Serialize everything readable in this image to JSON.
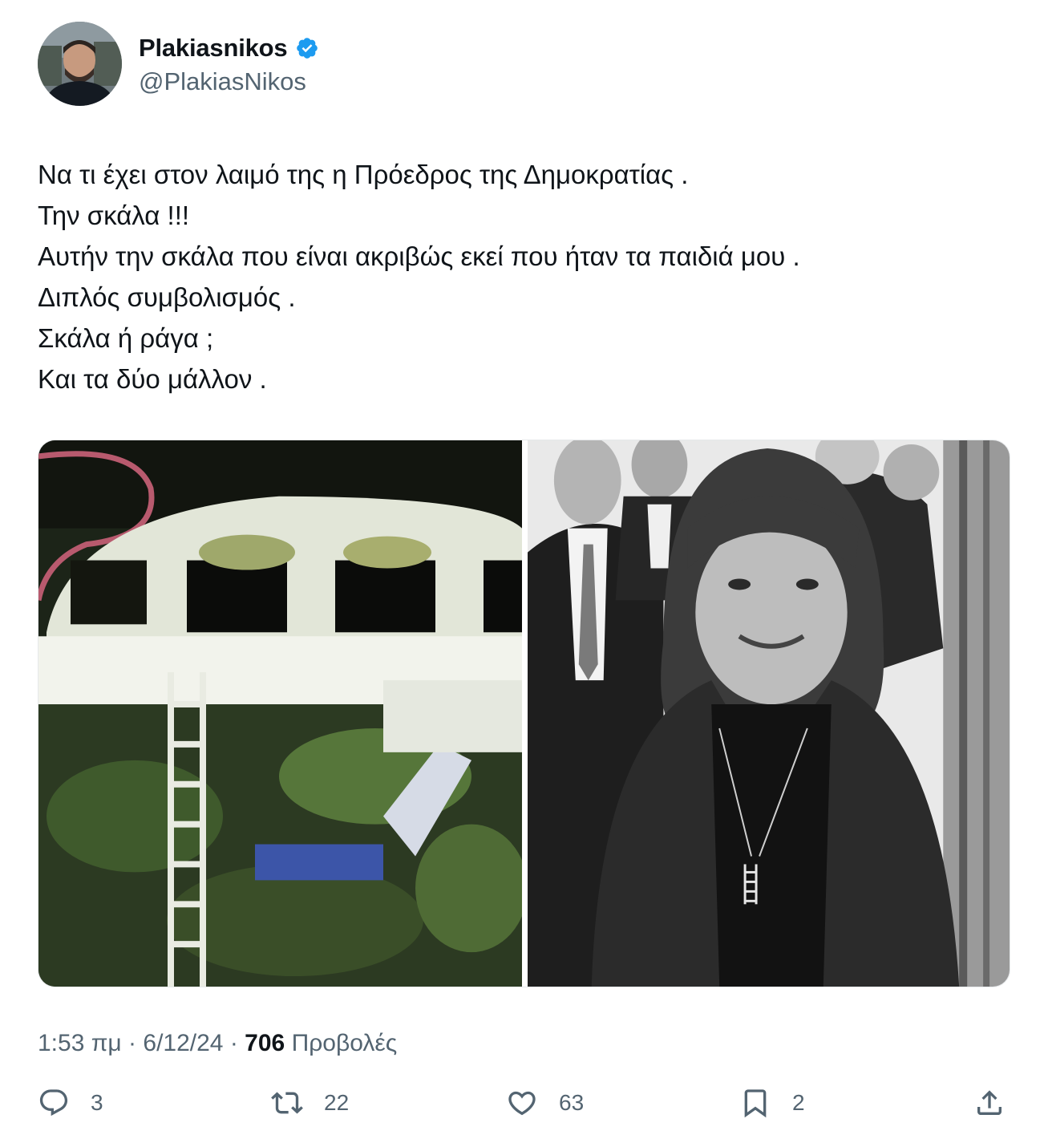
{
  "author": {
    "display_name": "Plakiasnikos",
    "handle": "@PlakiasNikos",
    "verified_icon": "verified-badge-icon",
    "accent_color": "#1d9bf0"
  },
  "tweet": {
    "lines": [
      "Να τι έχει στον λαιμό της η Πρόεδρος της Δημοκρατίας .",
      "Την σκάλα !!!",
      "Αυτήν την σκάλα που είναι ακριβώς εκεί που ήταν τα παιδιά μου .",
      "Διπλός συμβολισμός .",
      "Σκάλα ή ράγα ;",
      "Και τα δύο μάλλον ."
    ]
  },
  "media": {
    "count": 2
  },
  "meta": {
    "time": "1:53 πμ",
    "separator": " · ",
    "date": "6/12/24",
    "views_count": "706",
    "views_label": "Προβολές"
  },
  "actions": {
    "replies": "3",
    "reposts": "22",
    "likes": "63",
    "bookmarks": "2",
    "reply_icon": "reply-icon",
    "repost_icon": "repost-icon",
    "like_icon": "heart-icon",
    "bookmark_icon": "bookmark-icon",
    "share_icon": "share-icon"
  }
}
